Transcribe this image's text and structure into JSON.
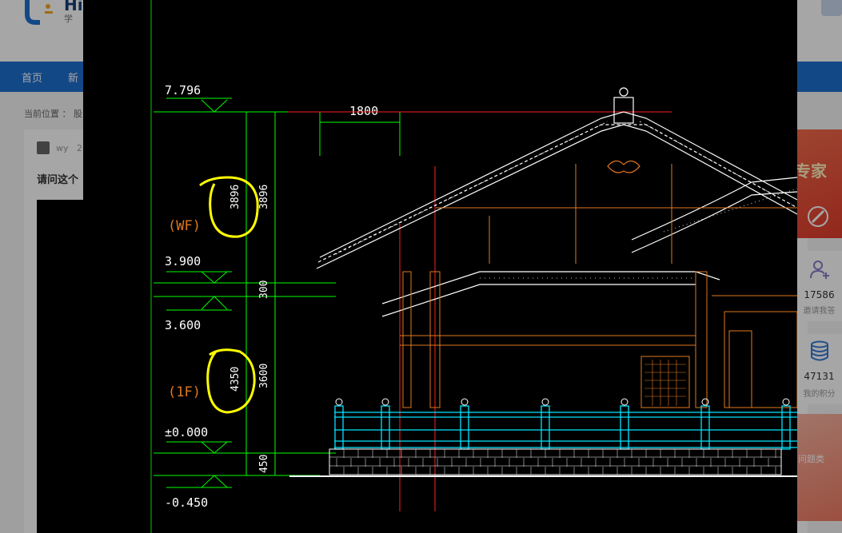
{
  "site": {
    "logo_text": "HiX",
    "logo_sub": "学 习"
  },
  "nav": {
    "items": [
      "首页",
      "新"
    ]
  },
  "breadcrumb": "当前位置 ： 股",
  "post": {
    "author": "wy",
    "date": "2",
    "title": "请问这个"
  },
  "sidebar": {
    "promo_text": "专家",
    "stats": [
      {
        "icon": "user-plus-icon",
        "value": "17586",
        "label": "邀请我答"
      },
      {
        "icon": "database-icon",
        "value": "47131",
        "label": "我的积分"
      }
    ],
    "promo2_text": "问题类"
  },
  "drawing": {
    "levels": {
      "top": "7.796",
      "l2": "3.900",
      "l1": "3.600",
      "ground": "±0.000",
      "base": "-0.450"
    },
    "floor_labels": {
      "wf": "(WF)",
      "f1": "(1F)"
    },
    "dims": {
      "top_span": "1800",
      "circled_upper": "3896",
      "upper": "3896",
      "mid": "300",
      "circled_lower": "4350",
      "lower": "3600",
      "bottom": "450"
    },
    "colors": {
      "green": "#00ff00",
      "white": "#ffffff",
      "orange": "#e07820",
      "cyan": "#00e5ff",
      "red": "#ff2020",
      "yellow": "#ffff00"
    }
  }
}
